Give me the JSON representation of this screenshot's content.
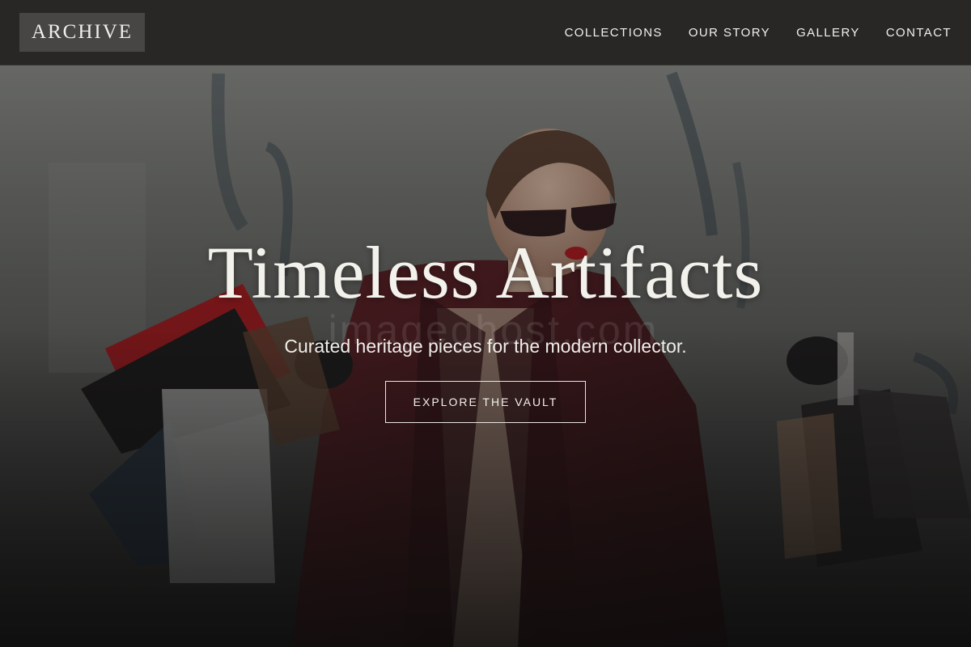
{
  "header": {
    "logo": "ARCHIVE",
    "nav": [
      {
        "label": "COLLECTIONS"
      },
      {
        "label": "OUR STORY"
      },
      {
        "label": "GALLERY"
      },
      {
        "label": "CONTACT"
      }
    ]
  },
  "hero": {
    "title": "Timeless Artifacts",
    "subtitle": "Curated heritage pieces for the modern collector.",
    "cta_label": "EXPLORE THE VAULT",
    "watermark": "imageghost.com",
    "photo_description_icon": "woman-with-shopping-bags-photo"
  },
  "colors": {
    "header_bg": "#282726",
    "logo_bg": "#474645",
    "text": "#f2f0ec",
    "coat": "#5a1a1f",
    "lips": "#c4161c"
  }
}
